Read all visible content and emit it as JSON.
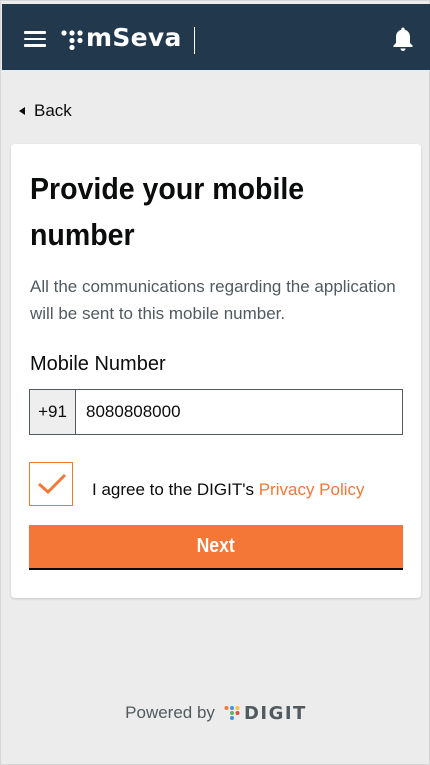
{
  "header": {
    "app_name": "mSeva",
    "menu_icon": "hamburger-menu-icon",
    "notification_icon": "bell-icon",
    "colors": {
      "background": "#22394d",
      "text": "#ffffff"
    }
  },
  "nav": {
    "back_label": "Back",
    "back_icon": "caret-left-icon"
  },
  "card": {
    "title": "Provide your mobile number",
    "description": "All the communications regarding the application will be sent to this mobile number.",
    "mobile_label": "Mobile Number",
    "country_code": "+91",
    "mobile_value": "8080808000",
    "consent_checked": true,
    "consent_prefix": "I agree to the DIGIT's",
    "privacy_link": "Privacy Policy",
    "next_label": "Next",
    "colors": {
      "accent": "#f47738",
      "text": "#0b0c0c",
      "muted": "#505a5f"
    }
  },
  "footer": {
    "powered_by": "Powered by",
    "brand": "DIGIT"
  }
}
